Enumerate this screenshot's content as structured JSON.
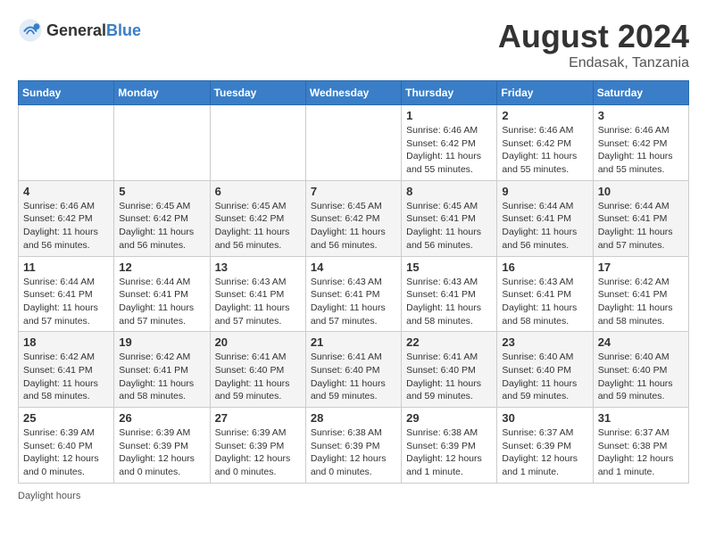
{
  "header": {
    "logo_general": "General",
    "logo_blue": "Blue",
    "month_title": "August 2024",
    "location": "Endasak, Tanzania"
  },
  "weekdays": [
    "Sunday",
    "Monday",
    "Tuesday",
    "Wednesday",
    "Thursday",
    "Friday",
    "Saturday"
  ],
  "weeks": [
    [
      {
        "day": "",
        "info": ""
      },
      {
        "day": "",
        "info": ""
      },
      {
        "day": "",
        "info": ""
      },
      {
        "day": "",
        "info": ""
      },
      {
        "day": "1",
        "info": "Sunrise: 6:46 AM\nSunset: 6:42 PM\nDaylight: 11 hours\nand 55 minutes."
      },
      {
        "day": "2",
        "info": "Sunrise: 6:46 AM\nSunset: 6:42 PM\nDaylight: 11 hours\nand 55 minutes."
      },
      {
        "day": "3",
        "info": "Sunrise: 6:46 AM\nSunset: 6:42 PM\nDaylight: 11 hours\nand 55 minutes."
      }
    ],
    [
      {
        "day": "4",
        "info": "Sunrise: 6:46 AM\nSunset: 6:42 PM\nDaylight: 11 hours\nand 56 minutes."
      },
      {
        "day": "5",
        "info": "Sunrise: 6:45 AM\nSunset: 6:42 PM\nDaylight: 11 hours\nand 56 minutes."
      },
      {
        "day": "6",
        "info": "Sunrise: 6:45 AM\nSunset: 6:42 PM\nDaylight: 11 hours\nand 56 minutes."
      },
      {
        "day": "7",
        "info": "Sunrise: 6:45 AM\nSunset: 6:42 PM\nDaylight: 11 hours\nand 56 minutes."
      },
      {
        "day": "8",
        "info": "Sunrise: 6:45 AM\nSunset: 6:41 PM\nDaylight: 11 hours\nand 56 minutes."
      },
      {
        "day": "9",
        "info": "Sunrise: 6:44 AM\nSunset: 6:41 PM\nDaylight: 11 hours\nand 56 minutes."
      },
      {
        "day": "10",
        "info": "Sunrise: 6:44 AM\nSunset: 6:41 PM\nDaylight: 11 hours\nand 57 minutes."
      }
    ],
    [
      {
        "day": "11",
        "info": "Sunrise: 6:44 AM\nSunset: 6:41 PM\nDaylight: 11 hours\nand 57 minutes."
      },
      {
        "day": "12",
        "info": "Sunrise: 6:44 AM\nSunset: 6:41 PM\nDaylight: 11 hours\nand 57 minutes."
      },
      {
        "day": "13",
        "info": "Sunrise: 6:43 AM\nSunset: 6:41 PM\nDaylight: 11 hours\nand 57 minutes."
      },
      {
        "day": "14",
        "info": "Sunrise: 6:43 AM\nSunset: 6:41 PM\nDaylight: 11 hours\nand 57 minutes."
      },
      {
        "day": "15",
        "info": "Sunrise: 6:43 AM\nSunset: 6:41 PM\nDaylight: 11 hours\nand 58 minutes."
      },
      {
        "day": "16",
        "info": "Sunrise: 6:43 AM\nSunset: 6:41 PM\nDaylight: 11 hours\nand 58 minutes."
      },
      {
        "day": "17",
        "info": "Sunrise: 6:42 AM\nSunset: 6:41 PM\nDaylight: 11 hours\nand 58 minutes."
      }
    ],
    [
      {
        "day": "18",
        "info": "Sunrise: 6:42 AM\nSunset: 6:41 PM\nDaylight: 11 hours\nand 58 minutes."
      },
      {
        "day": "19",
        "info": "Sunrise: 6:42 AM\nSunset: 6:41 PM\nDaylight: 11 hours\nand 58 minutes."
      },
      {
        "day": "20",
        "info": "Sunrise: 6:41 AM\nSunset: 6:40 PM\nDaylight: 11 hours\nand 59 minutes."
      },
      {
        "day": "21",
        "info": "Sunrise: 6:41 AM\nSunset: 6:40 PM\nDaylight: 11 hours\nand 59 minutes."
      },
      {
        "day": "22",
        "info": "Sunrise: 6:41 AM\nSunset: 6:40 PM\nDaylight: 11 hours\nand 59 minutes."
      },
      {
        "day": "23",
        "info": "Sunrise: 6:40 AM\nSunset: 6:40 PM\nDaylight: 11 hours\nand 59 minutes."
      },
      {
        "day": "24",
        "info": "Sunrise: 6:40 AM\nSunset: 6:40 PM\nDaylight: 11 hours\nand 59 minutes."
      }
    ],
    [
      {
        "day": "25",
        "info": "Sunrise: 6:39 AM\nSunset: 6:40 PM\nDaylight: 12 hours\nand 0 minutes."
      },
      {
        "day": "26",
        "info": "Sunrise: 6:39 AM\nSunset: 6:39 PM\nDaylight: 12 hours\nand 0 minutes."
      },
      {
        "day": "27",
        "info": "Sunrise: 6:39 AM\nSunset: 6:39 PM\nDaylight: 12 hours\nand 0 minutes."
      },
      {
        "day": "28",
        "info": "Sunrise: 6:38 AM\nSunset: 6:39 PM\nDaylight: 12 hours\nand 0 minutes."
      },
      {
        "day": "29",
        "info": "Sunrise: 6:38 AM\nSunset: 6:39 PM\nDaylight: 12 hours\nand 1 minute."
      },
      {
        "day": "30",
        "info": "Sunrise: 6:37 AM\nSunset: 6:39 PM\nDaylight: 12 hours\nand 1 minute."
      },
      {
        "day": "31",
        "info": "Sunrise: 6:37 AM\nSunset: 6:38 PM\nDaylight: 12 hours\nand 1 minute."
      }
    ]
  ],
  "footer": {
    "note": "Daylight hours"
  }
}
